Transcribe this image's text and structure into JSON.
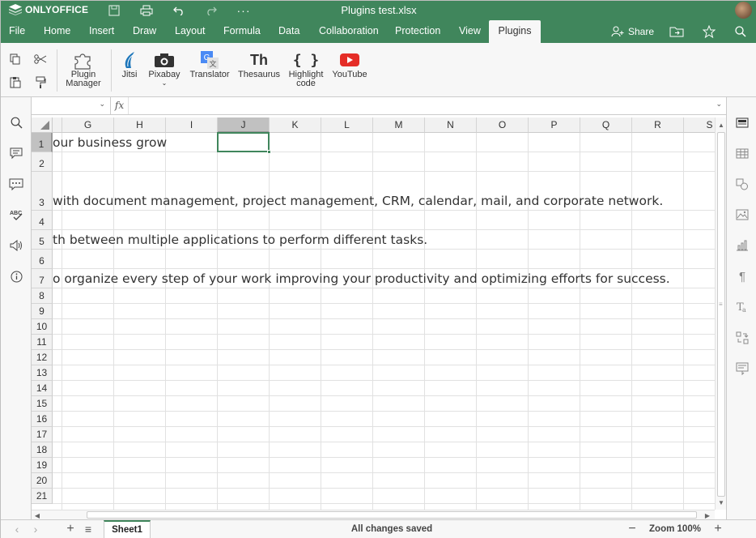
{
  "app": {
    "brand": "ONLYOFFICE",
    "title": "Plugins test.xlsx",
    "accent_color": "#40865c"
  },
  "quick_access": [
    "save-icon",
    "print-icon",
    "undo-icon",
    "redo-icon",
    "more-icon"
  ],
  "menu": {
    "tabs": [
      "File",
      "Home",
      "Insert",
      "Draw",
      "Layout",
      "Formula",
      "Data",
      "Collaboration",
      "Protection",
      "View",
      "Plugins"
    ],
    "active_tab": "Plugins",
    "share_label": "Share"
  },
  "toolbar": {
    "plugin_manager": "Plugin Manager",
    "plugins": [
      {
        "label": "Jitsi",
        "icon": "jitsi-icon"
      },
      {
        "label": "Pixabay",
        "icon": "pixabay-icon"
      },
      {
        "label": "Translator",
        "icon": "translator-icon"
      },
      {
        "label": "Thesaurus",
        "icon": "thesaurus-icon"
      },
      {
        "label": "Highlight code",
        "icon": "highlight-code-icon"
      },
      {
        "label": "YouTube",
        "icon": "youtube-icon"
      }
    ],
    "thesaurus_glyph": "Th",
    "highlight_glyph": "{ }"
  },
  "formula_bar": {
    "name_box": "",
    "fx_label": "fx",
    "formula": ""
  },
  "sheet": {
    "columns": [
      "G",
      "H",
      "I",
      "J",
      "K",
      "L",
      "M",
      "N",
      "O",
      "P",
      "Q",
      "R",
      "S"
    ],
    "selected_column": "J",
    "selected_row": "1",
    "rows": [
      "1",
      "2",
      "3",
      "4",
      "5",
      "6",
      "7",
      "8",
      "9",
      "10",
      "11",
      "12",
      "13",
      "14",
      "15",
      "16",
      "17",
      "18",
      "19",
      "20",
      "21"
    ],
    "cells": {
      "r1": "our business grow",
      "r3": "with document management, project management, CRM, calendar, mail, and corporate network.",
      "r5": "th between multiple applications to perform different tasks.",
      "r7": "o organize every step of your work improving your productivity and optimizing efforts for success."
    }
  },
  "status": {
    "sheet_tab": "Sheet1",
    "save_status": "All changes saved",
    "zoom": "Zoom 100%"
  }
}
